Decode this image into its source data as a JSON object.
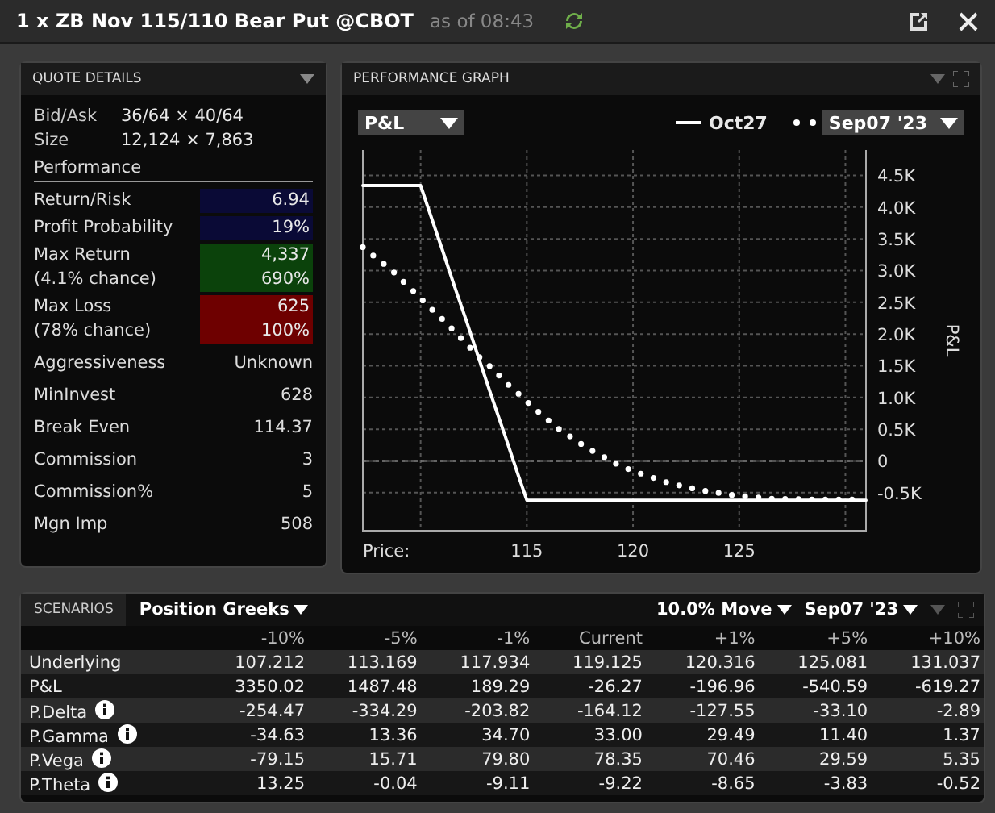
{
  "window": {
    "title": "1 x ZB Nov 115/110 Bear Put @CBOT",
    "as_of": "as of 08:43"
  },
  "quote_details": {
    "title": "QUOTE DETAILS",
    "quote": [
      {
        "label": "Bid/Ask",
        "value": "36/64 × 40/64"
      },
      {
        "label": "Size",
        "value": "12,124 × 7,863"
      }
    ],
    "section": "Performance",
    "rows": [
      {
        "kind": "bar",
        "label": "Return/Risk",
        "value": "6.94",
        "color": "#0a0a36"
      },
      {
        "kind": "bar",
        "label": "Profit Probability",
        "value": "19%",
        "color": "#0a0a36"
      },
      {
        "kind": "bar",
        "label": "Max Return",
        "label_2": "(4.1% chance)",
        "value": "4,337",
        "value_2": "690%",
        "color": "#0b420b"
      },
      {
        "kind": "bar",
        "label": "Max Loss",
        "label_2": "(78% chance)",
        "value": "625",
        "value_2": "100%",
        "color": "#6e0000"
      },
      {
        "kind": "plain",
        "label": "Aggressiveness",
        "value": "Unknown"
      },
      {
        "kind": "plain",
        "label": "MinInvest",
        "value": "628"
      },
      {
        "kind": "plain",
        "label": "Break Even",
        "value": "114.37"
      },
      {
        "kind": "plain",
        "label": "Commission",
        "value": "3"
      },
      {
        "kind": "plain",
        "label": "Commission%",
        "value": "5"
      },
      {
        "kind": "plain",
        "label": "Mgn Imp",
        "value": "508"
      }
    ]
  },
  "performance_graph": {
    "title": "PERFORMANCE GRAPH",
    "metric": "P&L",
    "chart_data": {
      "type": "line",
      "xlabel": "Price:",
      "ylabel": "P&L",
      "xlim": [
        107.28,
        130.97
      ],
      "ylim": [
        -1100,
        4900
      ],
      "grid": true,
      "ref_lines": [
        {
          "axis": "y",
          "value": 0
        }
      ],
      "xticks": [
        115,
        120,
        125
      ],
      "yticks": [
        {
          "value": -500,
          "label": "-0.5K"
        },
        0,
        {
          "value": 500,
          "label": "0.5K"
        },
        {
          "value": 1000,
          "label": "1.0K"
        },
        {
          "value": 1500,
          "label": "1.5K"
        },
        {
          "value": 2000,
          "label": "2.0K"
        },
        {
          "value": 2500,
          "label": "2.5K"
        },
        {
          "value": 3000,
          "label": "3.0K"
        },
        {
          "value": 3500,
          "label": "3.5K"
        },
        {
          "value": 4000,
          "label": "4.0K"
        },
        {
          "value": 4500,
          "label": "4.5K"
        }
      ],
      "x": [
        107.28,
        107.94,
        108.59,
        109.2,
        109.81,
        110,
        110.39,
        111.0,
        111.58,
        112.16,
        112.75,
        113.38,
        113.96,
        114.57,
        115,
        115.18,
        115.84,
        116.49,
        117.15,
        117.86,
        118.6,
        119.33,
        120.09,
        120.9,
        121.71,
        122.49,
        123.33,
        124.14,
        124.95,
        125.78,
        126.62,
        127.46,
        128.27,
        129.1,
        129.96,
        130.77,
        130.97
      ],
      "series": [
        {
          "name": "Oct27",
          "color": "#ffffff",
          "line_style": "solid",
          "values": [
            4340,
            4340,
            4340,
            4340,
            4340,
            4340,
            3950,
            3350,
            2770,
            2200,
            1610,
            980,
            410,
            -200,
            -620,
            -620,
            -620,
            -620,
            -620,
            -620,
            -620,
            -620,
            -620,
            -620,
            -620,
            -620,
            -620,
            -620,
            -620,
            -620,
            -620,
            -620,
            -620,
            -620,
            -620,
            -620,
            -620
          ]
        },
        {
          "name": "Sep07 '23",
          "color": "#ffffff",
          "line_style": "dotted",
          "values": [
            3370,
            3190,
            3020,
            2820,
            2630,
            null,
            2430,
            2240,
            2050,
            1840,
            1640,
            1460,
            1250,
            1070,
            null,
            880,
            690,
            510,
            360,
            200,
            70,
            -70,
            -170,
            -260,
            -350,
            -410,
            -470,
            -510,
            -550,
            -570,
            -600,
            -600,
            -610,
            -610,
            -610,
            -610,
            null
          ]
        }
      ]
    }
  },
  "scenarios": {
    "tab": "SCENARIOS",
    "view": "Position Greeks",
    "move": "10.0% Move",
    "date": "Sep07 '23",
    "columns": [
      "-10%",
      "-5%",
      "-1%",
      "Current",
      "+1%",
      "+5%",
      "+10%"
    ],
    "rows": [
      {
        "label": "Underlying",
        "info": false,
        "cells": [
          "107.212",
          "113.169",
          "117.934",
          "119.125",
          "120.316",
          "125.081",
          "131.037"
        ]
      },
      {
        "label": "P&L",
        "info": false,
        "cells": [
          "3350.02",
          "1487.48",
          "189.29",
          "-26.27",
          "-196.96",
          "-540.59",
          "-619.27"
        ]
      },
      {
        "label": "P.Delta",
        "info": true,
        "cells": [
          "-254.47",
          "-334.29",
          "-203.82",
          "-164.12",
          "-127.55",
          "-33.10",
          "-2.89"
        ]
      },
      {
        "label": "P.Gamma",
        "info": true,
        "cells": [
          "-34.63",
          "13.36",
          "34.70",
          "33.00",
          "29.49",
          "11.40",
          "1.37"
        ]
      },
      {
        "label": "P.Vega",
        "info": true,
        "cells": [
          "-79.15",
          "15.71",
          "79.80",
          "78.35",
          "70.46",
          "29.59",
          "5.35"
        ]
      },
      {
        "label": "P.Theta",
        "info": true,
        "cells": [
          "13.25",
          "-0.04",
          "-9.11",
          "-9.22",
          "-8.65",
          "-3.83",
          "-0.52"
        ]
      }
    ]
  }
}
